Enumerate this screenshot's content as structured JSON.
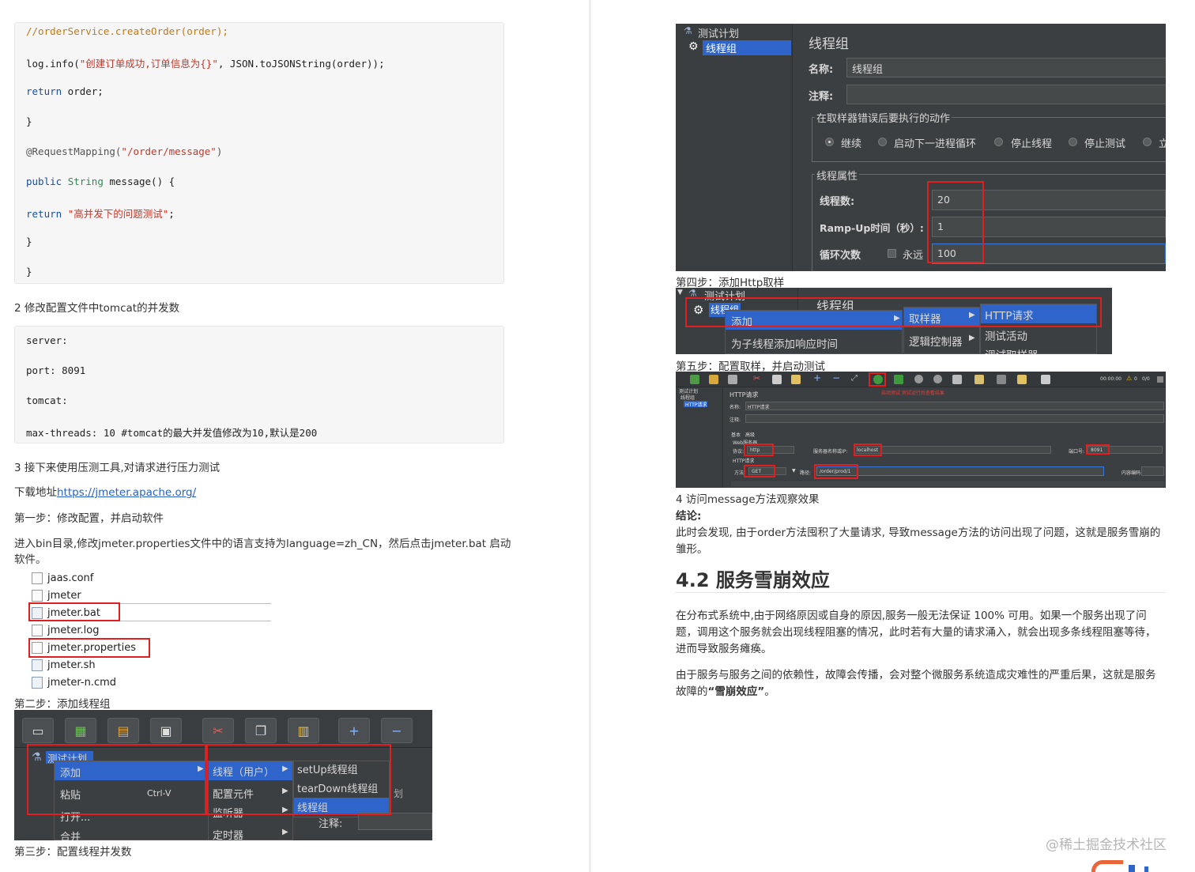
{
  "left": {
    "code1": [
      "//orderService.createOrder(order);",
      "log.info(\"创建订单成功,订单信息为{}\", JSON.toJSONString(order));",
      "return order;",
      "}",
      "@RequestMapping(\"/order/message\")",
      "public String message() {",
      "return \"高并发下的问题测试\";",
      "}",
      "}"
    ],
    "step2_heading": "2 修改配置文件中tomcat的并发数",
    "code2": [
      "server:",
      "port: 8091",
      "tomcat:",
      "max-threads: 10 #tomcat的最大并发值修改为10,默认是200"
    ],
    "step3_heading": "3 接下来使用压测工具,对请求进行压力测试",
    "download_label": "下载地址",
    "download_link": "https://jmeter.apache.org/",
    "step_one": "第一步：修改配置，并启动软件",
    "instructions_line1": "进入bin目录,修改jmeter.properties文件中的语言支持为language=zh_CN，然后点击jmeter.bat  启动",
    "instructions_line2": "软件。",
    "files": [
      "jaas.conf",
      "jmeter",
      "jmeter.bat",
      "jmeter.log",
      "jmeter.properties",
      "jmeter.sh",
      "jmeter-n.cmd"
    ],
    "step_two": "第二步：添加线程组",
    "shot2": {
      "tree_root": "测试计划",
      "menu1": [
        "添加",
        "粘贴",
        "打开...",
        "合并"
      ],
      "paste_shortcut": "Ctrl-V",
      "menu2": [
        "线程（用户）",
        "配置元件",
        "监听器",
        "定时器"
      ],
      "menu3": [
        "setUp线程组",
        "tearDown线程组",
        "线程组"
      ],
      "side_label": "注释:",
      "side_frag": "划"
    },
    "step_three": "第三步：配置线程并发数"
  },
  "right": {
    "shot1": {
      "tree_root": "测试计划",
      "tree_child": "线程组",
      "panel_title": "线程组",
      "name_label": "名称:",
      "name_value": "线程组",
      "comment_label": "注释:",
      "sampler_error_title": "在取样器错误后要执行的动作",
      "radio_options": [
        "继续",
        "启动下一进程循环",
        "停止线程",
        "停止测试",
        "立"
      ],
      "thread_props_title": "线程属性",
      "threads_label": "线程数:",
      "threads_value": "20",
      "rampup_label": "Ramp-Up时间（秒）:",
      "rampup_value": "1",
      "loop_label": "循环次数",
      "forever_label": "永远",
      "loop_value": "100"
    },
    "step_four": "第四步：添加Http取样",
    "shot3": {
      "tree_root": "测试计划",
      "tree_child": "线程组",
      "panel_title": "线程组",
      "menu1": [
        "添加",
        "为子线程添加响应时间"
      ],
      "menu2": [
        "取样器",
        "逻辑控制器"
      ],
      "menu3": [
        "HTTP请求",
        "测试活动",
        "调试取样器"
      ]
    },
    "step_five": "第五步：配置取样，并启动测试",
    "shot4": {
      "panel_title": "HTTP请求",
      "name_label": "名称:",
      "name_value": "HTTP请求",
      "comment_label": "注释:",
      "tab_basic": "基本",
      "tab_adv": "高级",
      "web_server": "Web服务器",
      "protocol_label": "协议:",
      "protocol_value": "http",
      "server_label": "服务器名称或IP:",
      "server_value": "localhost",
      "port_label": "端口号:",
      "port_value": "8091",
      "http_request": "HTTP请求",
      "method_label": "方法:",
      "method_value": "GET",
      "path_label": "路径:",
      "path_value": "/order/prod/1",
      "encoding_label": "内容编码:",
      "tree_root": "测试计划",
      "tree_child": "线程组",
      "tree_leaf": "HTTP请求",
      "toolbar_time": "00:00:00",
      "toolbar_warn": "0",
      "toolbar_count": "0/0",
      "toolbar_note": "启动测试 测试运行后查看结果"
    },
    "observe_heading": "4 访问message方法观察效果",
    "conclusion_label": "结论:",
    "conclusion_line1": "此时会发现, 由于order方法囤积了大量请求, 导致message方法的访问出现了问题，这就是服务雪崩的",
    "conclusion_line2": "雏形。",
    "section_title": "4.2 服务雪崩效应",
    "para1_line1": "在分布式系统中,由于网络原因或自身的原因,服务一般无法保证 100% 可用。如果一个服务出现了问",
    "para1_line2": "题，调用这个服务就会出现线程阻塞的情况，此时若有大量的请求涌入，就会出现多条线程阻塞等待，",
    "para1_line3": "进而导致服务瘫痪。",
    "para2_line1": "由于服务与服务之间的依赖性，故障会传播，会对整个微服务系统造成灾难性的严重后果，这就是服务",
    "para2_prefix": "故障的",
    "para2_bold": "“雪崩效应”",
    "para2_suffix": "。",
    "watermark": "@稀土掘金技术社区"
  },
  "colors": {
    "highlight_red": "#e02020",
    "link_blue": "#2962c4",
    "jmeter_bg": "#3c3f41",
    "selection_blue": "#2f65ca"
  }
}
